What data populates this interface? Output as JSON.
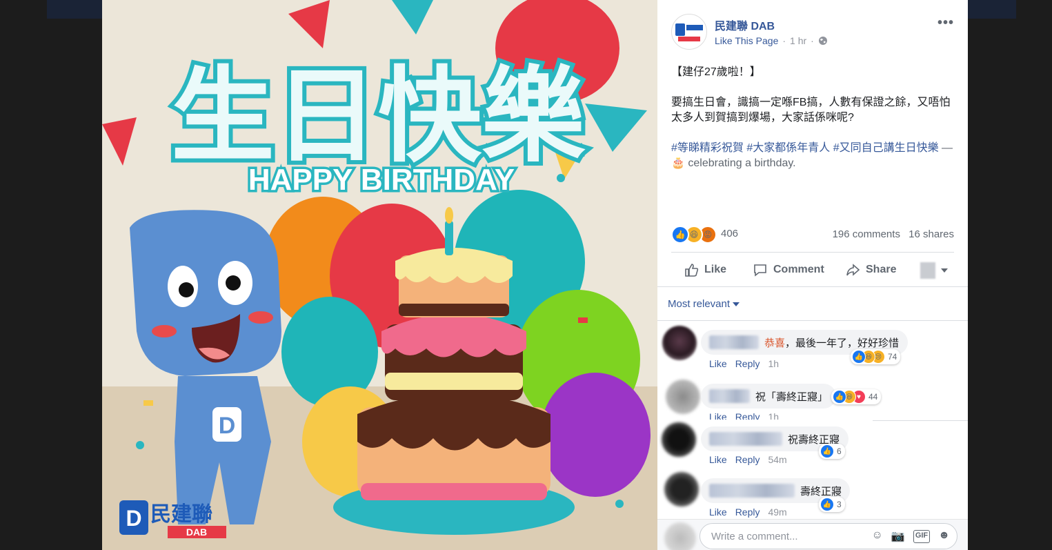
{
  "page": {
    "name": "民建聯 DAB",
    "like_this_page": "Like This Page",
    "separator": "·",
    "time": "1 hr",
    "more": "•••"
  },
  "post": {
    "headline": "【建仔27歲啦！】",
    "body": "要搞生日會，識搞一定喺FB搞，人數有保證之餘，又唔怕太多人到賀搞到爆場，大家話係咪呢?",
    "hashtags": "#等睇精彩祝賀 #大家都係年青人 #又同自己講生日快樂",
    "activity_prefix": " — ",
    "activity": "celebrating a birthday."
  },
  "photo": {
    "title_cn": "生日快樂",
    "title_en": "HAPPY BIRTHDAY",
    "logo_cn": "民建聯",
    "logo_en": "DAB"
  },
  "stats": {
    "reactions": "406",
    "comments": "196 comments",
    "shares": "16 shares"
  },
  "actions": {
    "like": "Like",
    "comment": "Comment",
    "share": "Share"
  },
  "sort": {
    "label": "Most relevant"
  },
  "comments": [
    {
      "highlight": "恭喜",
      "text": "，最後一年了，好好珍惜",
      "reactions": "74",
      "like": "Like",
      "reply": "Reply",
      "time": "1h"
    },
    {
      "text": "祝「壽終正寢」",
      "reactions": "44",
      "like": "Like",
      "reply": "Reply",
      "time": "1h"
    },
    {
      "text": "祝壽終正寢",
      "reactions": "6",
      "like": "Like",
      "reply": "Reply",
      "time": "54m"
    },
    {
      "text": "壽終正寢",
      "reactions": "3",
      "like": "Like",
      "reply": "Reply",
      "time": "49m"
    }
  ],
  "composer": {
    "placeholder": "Write a comment..."
  },
  "icons": [
    "globe-icon",
    "like-icon",
    "comment-icon",
    "share-icon",
    "caret-down-icon",
    "emoji-icon",
    "camera-icon",
    "gif-icon",
    "sticker-icon"
  ],
  "colors": {
    "link": "#365899",
    "like_blue": "#1877f2",
    "teal": "#2ab6c0"
  }
}
